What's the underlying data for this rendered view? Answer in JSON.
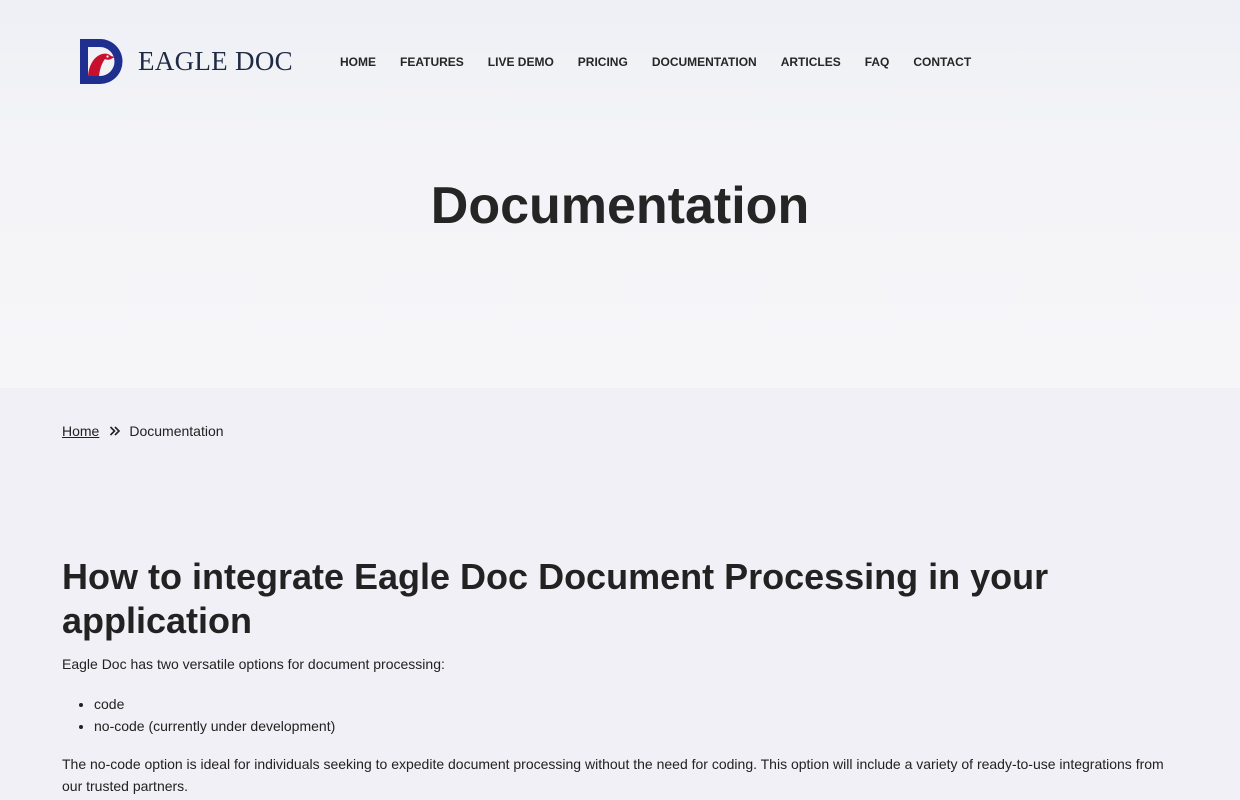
{
  "header": {
    "logo_text": "EAGLE DOC",
    "brand_colors": {
      "blue": "#1e2f8f",
      "red": "#c8102e"
    },
    "nav": [
      {
        "label": "HOME"
      },
      {
        "label": "FEATURES"
      },
      {
        "label": "LIVE DEMO"
      },
      {
        "label": "PRICING"
      },
      {
        "label": "DOCUMENTATION"
      },
      {
        "label": "ARTICLES"
      },
      {
        "label": "FAQ"
      },
      {
        "label": "CONTACT"
      }
    ]
  },
  "hero": {
    "title": "Documentation"
  },
  "breadcrumb": {
    "home": "Home",
    "separator_icon": "double-chevron-right-icon",
    "current": "Documentation"
  },
  "article": {
    "title": "How to integrate Eagle Doc Document Processing in your application",
    "intro": "Eagle Doc has two versatile options for document processing:",
    "options": [
      "code",
      "no-code (currently under development)"
    ],
    "paragraph": "The no-code option is ideal for individuals seeking to expedite document processing without the need for coding. This option will include a variety of ready-to-use integrations from our trusted partners."
  }
}
